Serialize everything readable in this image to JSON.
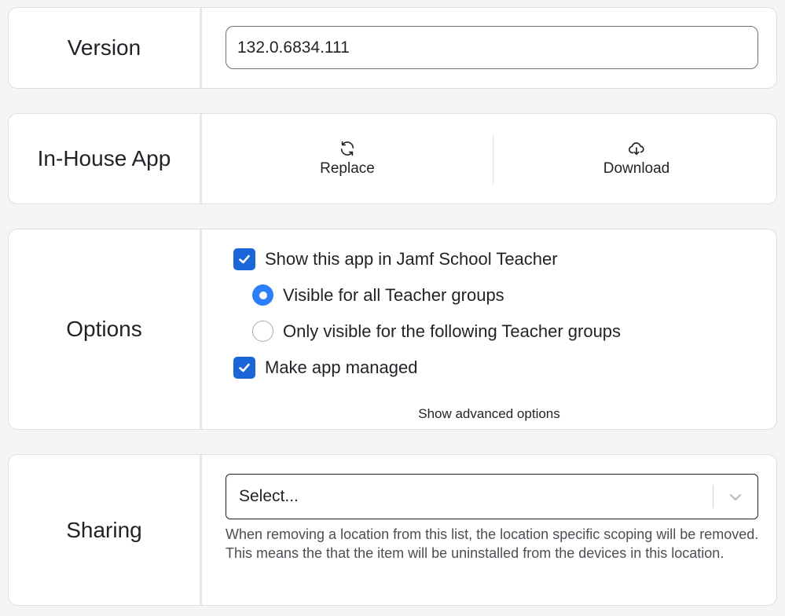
{
  "version": {
    "label": "Version",
    "value": "132.0.6834.111"
  },
  "inhouse": {
    "label": "In-House App",
    "replace_label": "Replace",
    "download_label": "Download"
  },
  "options": {
    "label": "Options",
    "show_in_teacher": "Show this app in Jamf School Teacher",
    "visible_all": "Visible for all Teacher groups",
    "only_visible": "Only visible for the following Teacher groups",
    "make_managed": "Make app managed",
    "advanced": "Show advanced options"
  },
  "sharing": {
    "label": "Sharing",
    "select_placeholder": "Select...",
    "help": "When removing a location from this list, the location specific scoping will be removed. This means the that the item will be uninstalled from the devices in this location."
  },
  "colors": {
    "accent": "#1a66d9",
    "radio_accent": "#2d7ff9",
    "background": "#f4f5f7"
  },
  "icons": {
    "replace": "refresh-icon",
    "download": "cloud-download-icon",
    "check": "check-icon",
    "dropdown": "chevron-down-icon"
  }
}
